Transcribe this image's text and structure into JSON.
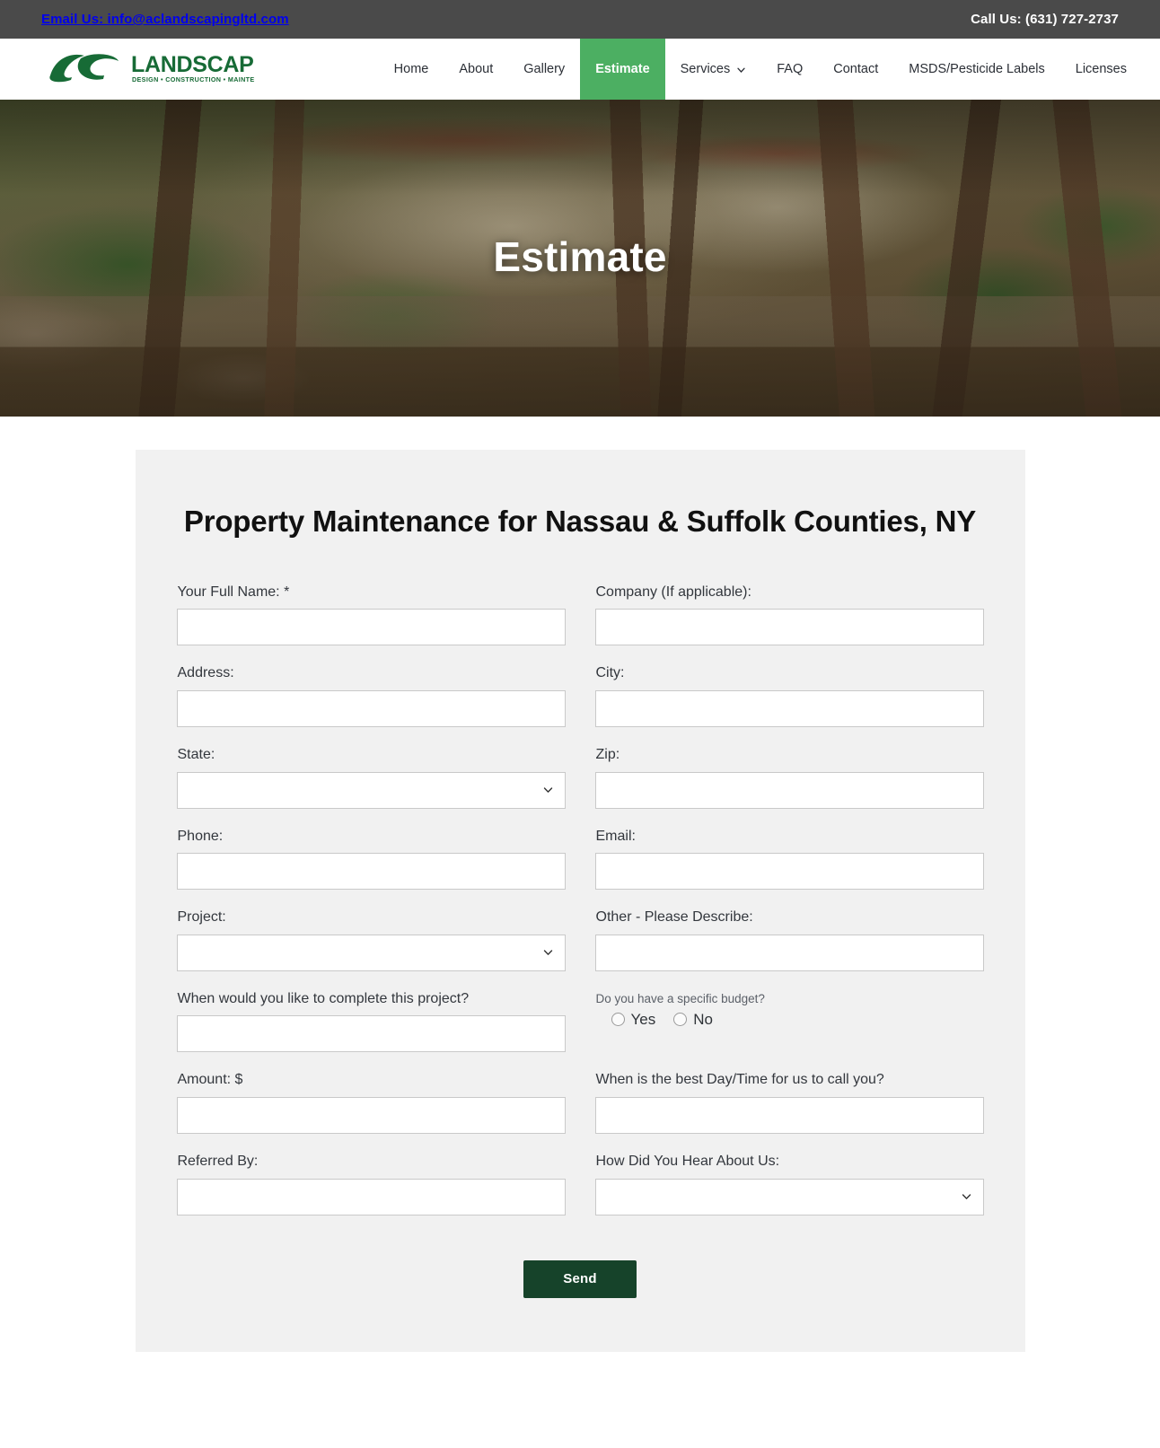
{
  "topbar": {
    "email_label": "Email Us: info@aclandscapingltd.com",
    "phone_label": "Call Us: (631) 727-2737",
    "background": "#4a4a4a"
  },
  "brand": {
    "initials": "AC",
    "name": "LANDSCAPING",
    "tagline": "DESIGN • CONSTRUCTION • MAINTENANCE",
    "color": "#176b36"
  },
  "nav": {
    "active_color": "#4caf62",
    "items": [
      {
        "label": "Home",
        "active": false,
        "has_caret": false
      },
      {
        "label": "About",
        "active": false,
        "has_caret": false
      },
      {
        "label": "Gallery",
        "active": false,
        "has_caret": false
      },
      {
        "label": "Estimate",
        "active": true,
        "has_caret": false
      },
      {
        "label": "Services",
        "active": false,
        "has_caret": true
      },
      {
        "label": "FAQ",
        "active": false,
        "has_caret": false
      },
      {
        "label": "Contact",
        "active": false,
        "has_caret": false
      },
      {
        "label": "MSDS/Pesticide Labels",
        "active": false,
        "has_caret": false
      },
      {
        "label": "Licenses",
        "active": false,
        "has_caret": false
      }
    ]
  },
  "hero": {
    "title": "Estimate"
  },
  "form": {
    "heading": "Property Maintenance for Nassau & Suffolk Counties, NY",
    "fields": {
      "full_name": {
        "label": "Your Full Name: *",
        "value": "",
        "placeholder": ""
      },
      "company": {
        "label": "Company (If applicable):",
        "value": "",
        "placeholder": ""
      },
      "address": {
        "label": "Address:",
        "value": "",
        "placeholder": ""
      },
      "city": {
        "label": "City:",
        "value": "",
        "placeholder": ""
      },
      "state": {
        "label": "State:",
        "value": "",
        "placeholder": ""
      },
      "zip": {
        "label": "Zip:",
        "value": "",
        "placeholder": ""
      },
      "phone": {
        "label": "Phone:",
        "value": "",
        "placeholder": ""
      },
      "email": {
        "label": "Email:",
        "value": "",
        "placeholder": ""
      },
      "project": {
        "label": "Project:",
        "value": "",
        "placeholder": ""
      },
      "other": {
        "label": "Other - Please Describe:",
        "value": "",
        "placeholder": ""
      },
      "complete_when": {
        "label": "When would you like to complete this project?",
        "value": "",
        "placeholder": ""
      },
      "amount": {
        "label": "Amount: $",
        "value": "",
        "placeholder": ""
      },
      "best_time": {
        "label": "When is the best Day/Time for us to call you?",
        "value": "",
        "placeholder": ""
      },
      "referred_by": {
        "label": "Referred By:",
        "value": "",
        "placeholder": ""
      },
      "how_heard": {
        "label": "How Did You Hear About Us:",
        "value": "",
        "placeholder": ""
      }
    },
    "budget": {
      "question": "Do you have a specific budget?",
      "yes_label": "Yes",
      "no_label": "No",
      "selected": ""
    },
    "submit_label": "Send",
    "submit_color": "#16432a"
  }
}
